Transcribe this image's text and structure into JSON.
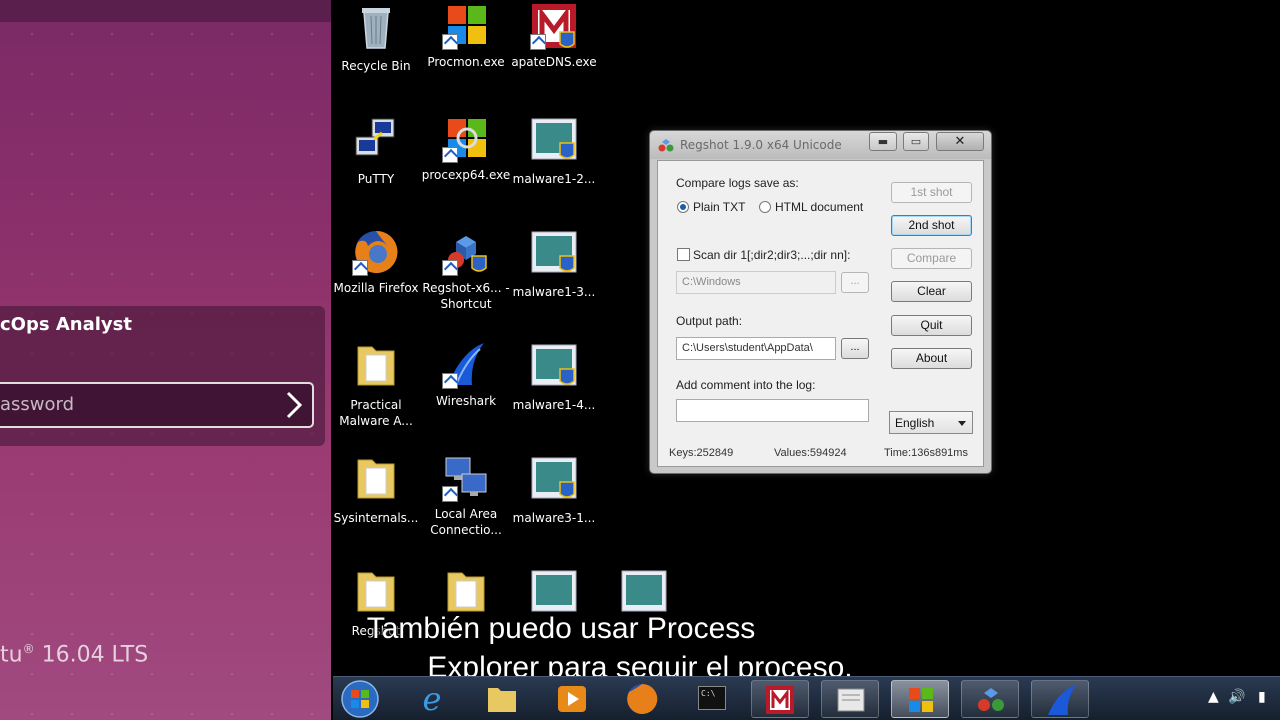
{
  "ubuntu": {
    "user_name": "cOps Analyst",
    "password_placeholder": "assword",
    "version_prefix": "tu",
    "version_mark": "®",
    "version": "16.04 LTS"
  },
  "desktop_icons": [
    {
      "label": "Recycle Bin"
    },
    {
      "label": "Procmon.exe"
    },
    {
      "label": "apateDNS.exe"
    },
    {
      "label": "PuTTY"
    },
    {
      "label": "procexp64.exe"
    },
    {
      "label": "malware1-2..."
    },
    {
      "label": "Mozilla Firefox"
    },
    {
      "label": "Regshot-x6... - Shortcut"
    },
    {
      "label": "malware1-3..."
    },
    {
      "label": "Practical Malware A..."
    },
    {
      "label": "Wireshark"
    },
    {
      "label": "malware1-4..."
    },
    {
      "label": "Sysinternals..."
    },
    {
      "label": "Local Area Connectio..."
    },
    {
      "label": "malware3-1..."
    },
    {
      "label": "Regshot"
    }
  ],
  "regshot": {
    "title": "Regshot 1.9.0 x64 Unicode",
    "compare_logs_label": "Compare logs save as:",
    "plain_txt": "Plain TXT",
    "html_document": "HTML document",
    "scan_dir_label": "Scan dir 1[;dir2;dir3;...;dir nn]:",
    "scan_dir_value": "C:\\Windows",
    "browse": "...",
    "output_path_label": "Output path:",
    "output_path_value": "C:\\Users\\student\\AppData\\",
    "comment_label": "Add comment into the log:",
    "comment_value": "",
    "buttons": {
      "first_shot": "1st shot",
      "second_shot": "2nd shot",
      "compare": "Compare",
      "clear": "Clear",
      "quit": "Quit",
      "about": "About"
    },
    "language": "English",
    "keys": "Keys:252849",
    "values": "Values:594924",
    "time": "Time:136s891ms"
  },
  "subtitles": {
    "line1": "También puedo usar Process",
    "line2": "Explorer para seguir el proceso,"
  },
  "taskbar": {
    "start": "start-orb",
    "items": [
      "internet-explorer",
      "file-explorer",
      "media-player",
      "firefox",
      "command-prompt",
      "apatedns",
      "notepad",
      "procmon",
      "regshot",
      "wireshark"
    ],
    "cmd_text": "C:\\"
  },
  "colors": {
    "ubuntu_purple": "#8a2f6a",
    "taskbar": "#1c2a3e",
    "window_gray": "#c9c9c9"
  }
}
